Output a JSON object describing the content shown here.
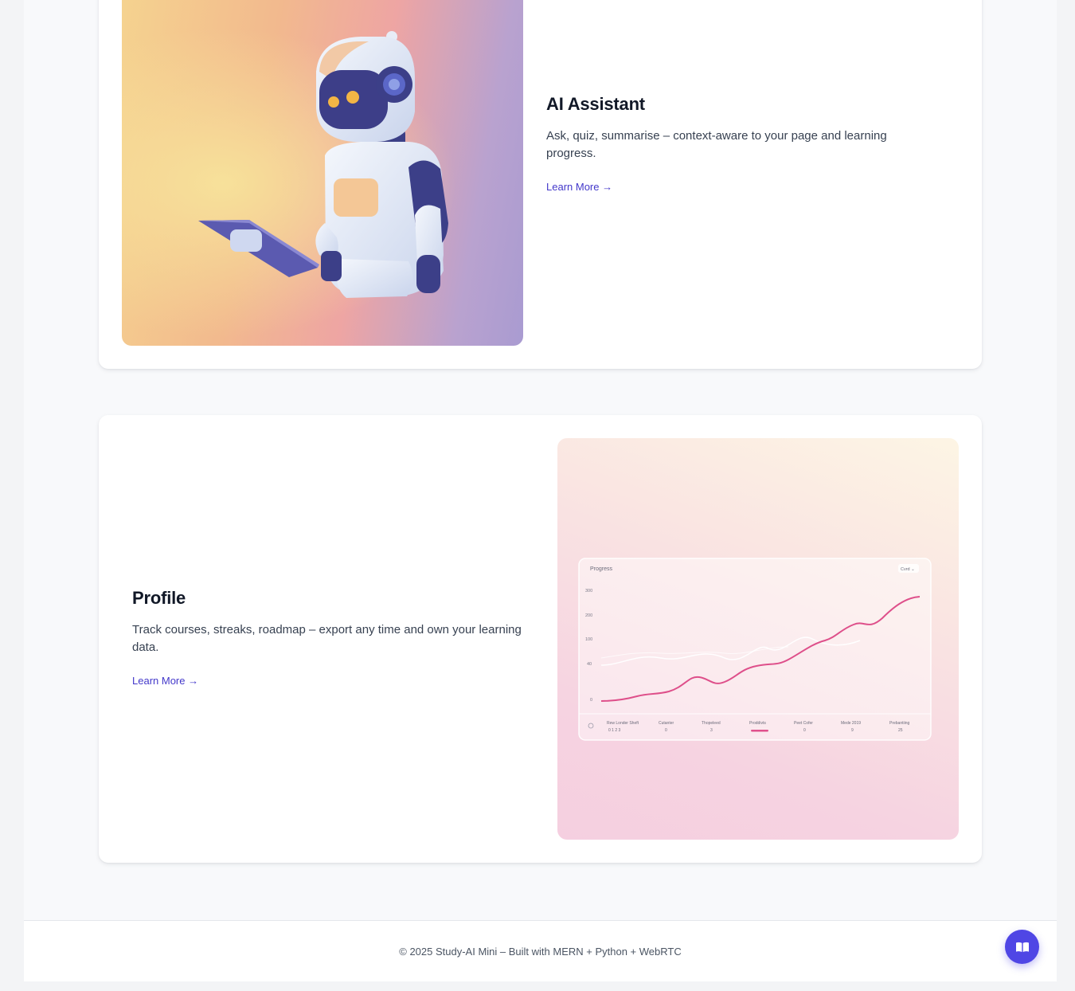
{
  "features": [
    {
      "title": "AI Assistant",
      "description": "Ask, quiz, summarise – context-aware to your page and learning progress.",
      "link_label": "Learn More →",
      "image_icon": "robot-illustration"
    },
    {
      "title": "Profile",
      "description": "Track courses, streaks, roadmap – export any time and own your learning data.",
      "link_label": "Learn More →",
      "image_icon": "progress-chart-illustration"
    }
  ],
  "progress_panel": {
    "title": "Progress",
    "dropdown": "Cvrd ⌄",
    "y_ticks": [
      "300",
      "200",
      "100",
      "40",
      "0"
    ],
    "x_categories": [
      {
        "label": "Rew Londer Sheft",
        "value": "0  1  2  3"
      },
      {
        "label": "Cutanter",
        "value": "0"
      },
      {
        "label": "Thopeleed",
        "value": "3"
      },
      {
        "label": "Proddivts",
        "value": ""
      },
      {
        "label": "Peet Cofer",
        "value": "0"
      },
      {
        "label": "Mede 2019",
        "value": "9"
      },
      {
        "label": "Prebantiing",
        "value": "25"
      }
    ]
  },
  "footer": {
    "text": "© 2025 Study-AI Mini – Built with MERN + Python + WebRTC"
  },
  "fab": {
    "icon": "open-book-icon"
  },
  "colors": {
    "accent": "#4f46e5",
    "link": "#4338ca"
  }
}
